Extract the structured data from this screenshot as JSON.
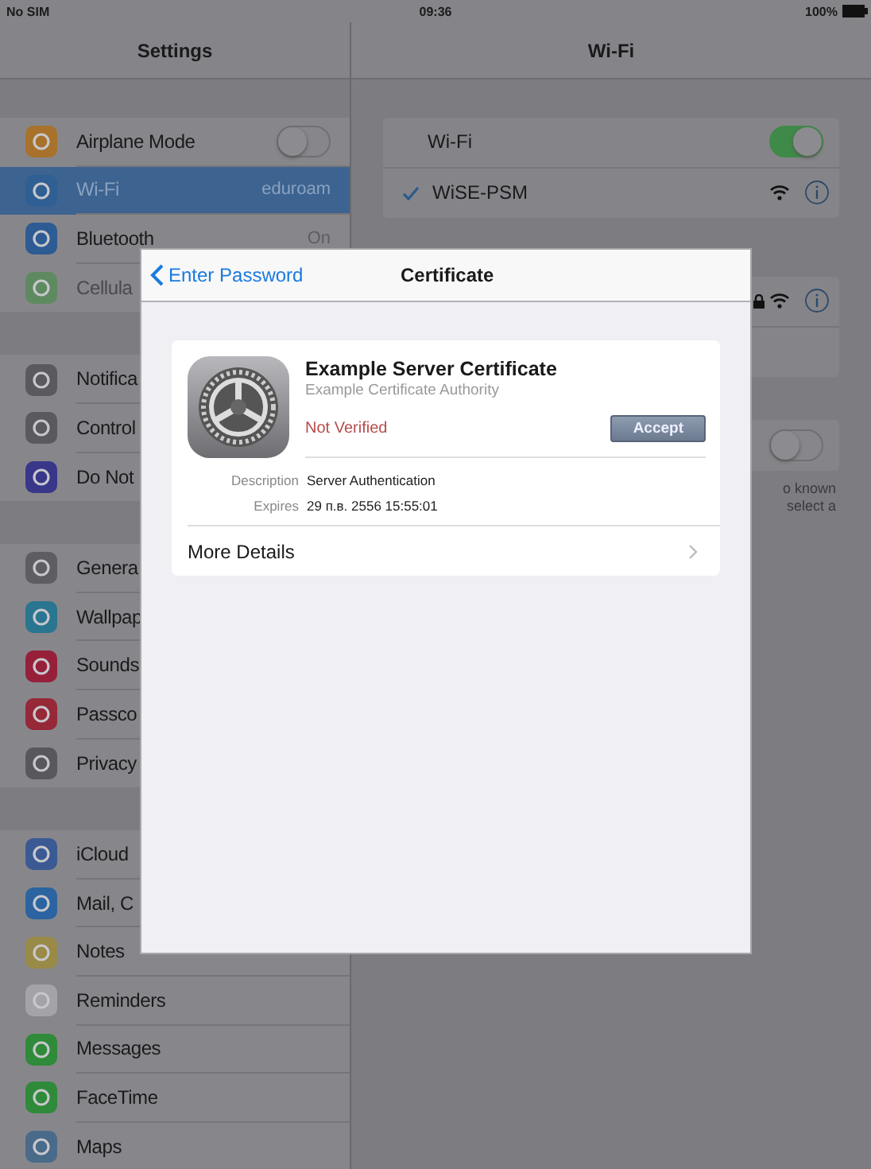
{
  "status_bar": {
    "carrier": "No SIM",
    "time": "09:36",
    "battery": "100%"
  },
  "sidebar": {
    "title": "Settings",
    "groups": [
      {
        "items": [
          {
            "label": "Airplane Mode",
            "color": "#a8722c",
            "kind": "toggle",
            "on": false,
            "selected": false,
            "disabled": false
          },
          {
            "label": "Wi-Fi",
            "detail": "eduroam",
            "color": "#2f5f93",
            "kind": "detail",
            "selected": true,
            "disabled": false
          },
          {
            "label": "Bluetooth",
            "detail": "On",
            "color": "#2d5b93",
            "kind": "detail",
            "selected": false,
            "disabled": false
          },
          {
            "label": "Cellula",
            "color": "#5e8a60",
            "kind": "plain",
            "selected": false,
            "disabled": true
          }
        ]
      },
      {
        "items": [
          {
            "label": "Notifica",
            "color": "#5a5a5e",
            "kind": "plain",
            "selected": false,
            "disabled": false
          },
          {
            "label": "Control",
            "color": "#5a5a5e",
            "kind": "plain",
            "selected": false,
            "disabled": false
          },
          {
            "label": "Do Not",
            "color": "#39378a",
            "kind": "plain",
            "selected": false,
            "disabled": false
          }
        ]
      },
      {
        "items": [
          {
            "label": "Genera",
            "color": "#5e5e62",
            "kind": "plain",
            "selected": false,
            "disabled": false
          },
          {
            "label": "Wallpap",
            "color": "#2a7590",
            "kind": "plain",
            "selected": false,
            "disabled": false
          },
          {
            "label": "Sounds",
            "color": "#96203a",
            "kind": "plain",
            "selected": false,
            "disabled": false
          },
          {
            "label": "Passco",
            "color": "#962838",
            "kind": "plain",
            "selected": false,
            "disabled": false
          },
          {
            "label": "Privacy",
            "color": "#58585c",
            "kind": "plain",
            "selected": false,
            "disabled": false
          }
        ]
      },
      {
        "items": [
          {
            "label": "iCloud",
            "color": "#3b5a94",
            "kind": "plain",
            "selected": false,
            "disabled": false
          },
          {
            "label": "Mail, C",
            "color": "#2b64a0",
            "kind": "plain",
            "selected": false,
            "disabled": false
          },
          {
            "label": "Notes",
            "color": "#9a8a48",
            "kind": "plain",
            "selected": false,
            "disabled": false
          },
          {
            "label": "Reminders",
            "color": "#a4a4a8",
            "kind": "plain",
            "selected": false,
            "disabled": false
          },
          {
            "label": "Messages",
            "color": "#2f8a3a",
            "kind": "plain",
            "selected": false,
            "disabled": false
          },
          {
            "label": "FaceTime",
            "color": "#2f8a3a",
            "kind": "plain",
            "selected": false,
            "disabled": false
          },
          {
            "label": "Maps",
            "color": "#4a6a8a",
            "kind": "plain",
            "selected": false,
            "disabled": false
          }
        ]
      }
    ]
  },
  "wifi_panel": {
    "title": "Wi-Fi",
    "groups": [
      {
        "rows": [
          {
            "kind": "toggle",
            "label": "Wi-Fi",
            "on": true
          },
          {
            "kind": "network",
            "label": "WiSE-PSM",
            "checked": true,
            "locked": false
          }
        ]
      },
      {
        "rows": [
          {
            "kind": "network",
            "locked": true
          },
          {
            "kind": "blank"
          }
        ]
      },
      {
        "rows": [
          {
            "kind": "toggle",
            "on": false
          }
        ]
      }
    ],
    "footer_lines": [
      "o known",
      "select a"
    ]
  },
  "modal": {
    "back_label": "Enter Password",
    "title": "Certificate",
    "certificate": {
      "name": "Example Server Certificate",
      "issuer": "Example Certificate Authority",
      "status": "Not Verified",
      "verified": false,
      "accept_label": "Accept",
      "details": [
        {
          "label": "Description",
          "value": "Server Authentication"
        },
        {
          "label": "Expires",
          "value": "29 п.в. 2556 15:55:01"
        }
      ],
      "more_label": "More Details"
    }
  }
}
